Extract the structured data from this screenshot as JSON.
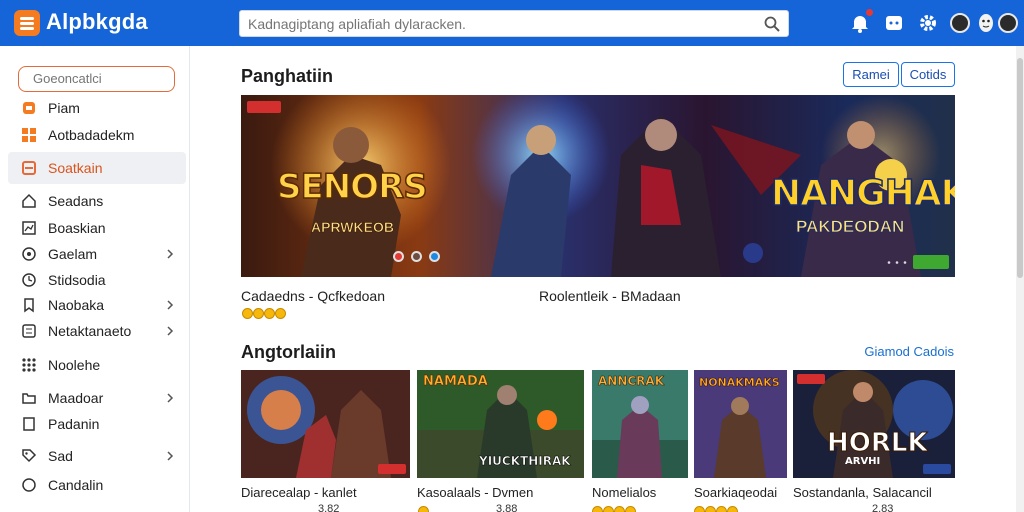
{
  "app": {
    "title": "Alpbkgda"
  },
  "search": {
    "placeholder": "Kadnagiptang apliafiah dylaracken."
  },
  "sidebar": {
    "search_placeholder": "Goeoncatlci",
    "items": [
      {
        "label": "Piam",
        "icon": "game-icon"
      },
      {
        "label": "Aotbadadekm",
        "icon": "grid-icon"
      },
      {
        "label": "Soatkain",
        "icon": "tablet-icon",
        "active": true
      },
      {
        "label": "Seadans",
        "icon": "home-icon"
      },
      {
        "label": "Boaskian",
        "icon": "chart-icon"
      },
      {
        "label": "Gaelam",
        "icon": "compass-icon",
        "chevron": true
      },
      {
        "label": "Stidsodia",
        "icon": "clock-icon"
      },
      {
        "label": "Naobaka",
        "icon": "bookmark-icon",
        "chevron": true
      },
      {
        "label": "Netaktanaeto",
        "icon": "list-icon",
        "chevron": true
      },
      {
        "label": "Noolehe",
        "icon": "apps-icon"
      },
      {
        "label": "Maadoar",
        "icon": "folder-icon",
        "chevron": true
      },
      {
        "label": "Padanin",
        "icon": "doc-icon"
      },
      {
        "label": "Sad",
        "icon": "tag-icon",
        "chevron": true
      },
      {
        "label": "Candalin",
        "icon": "shield-icon"
      }
    ]
  },
  "featured": {
    "title": "Panghatiin",
    "btn_primary": "Ramei",
    "btn_secondary": "Cotids",
    "hero": {
      "left_title": "SENORS",
      "left_subtitle": "APRWKEOB",
      "right_title": "NANGHAK",
      "right_subtitle": "PAKDEODAN"
    },
    "captions": [
      {
        "text": "Cadaedns - Qcfkedoan"
      },
      {
        "text": "Roolentleik - BMadaan"
      }
    ],
    "rating_coins": 4
  },
  "recommended": {
    "title": "Angtorlaiin",
    "link": "Giamod Cadois",
    "cards": [
      {
        "title": "",
        "label": "Diarecealap - kanlet",
        "value": "3.82"
      },
      {
        "title": "NAMADA",
        "banner": "YIUCKTHIRAK",
        "label": "Kasoalaals - Dvmen",
        "value": "3.88"
      },
      {
        "title": "ANNCRAK",
        "label": "Nomelialos",
        "value": ""
      },
      {
        "title": "NONAKMAKS",
        "label": "Soarkiaqeodai",
        "value": ""
      },
      {
        "title": "HORLK",
        "banner": "ARVHI",
        "label": "Sostandanla, Salacancil",
        "value": "2.83"
      }
    ]
  },
  "colors": {
    "topbar": "#1565d8",
    "accent": "#e36b3b",
    "link": "#1a6fd1"
  }
}
